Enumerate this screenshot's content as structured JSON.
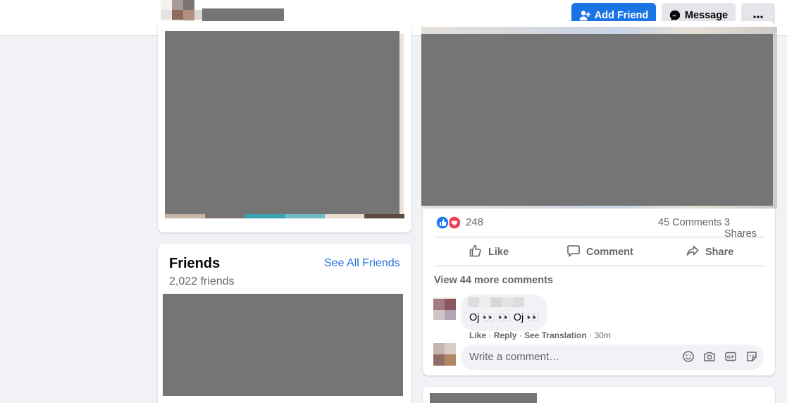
{
  "header": {
    "add_friend_label": "Add Friend",
    "message_label": "Message",
    "more_icon": "more-horizontal-icon",
    "brand_color": "#1b74e4"
  },
  "friends": {
    "title": "Friends",
    "count": "2,022 friends",
    "see_all_label": "See All Friends"
  },
  "post": {
    "reaction_icons": [
      "like-reaction-icon",
      "love-reaction-icon"
    ],
    "reaction_count": "248",
    "comments_count": "45 Comments",
    "shares_count": "3 Shares",
    "actions": {
      "like": "Like",
      "comment": "Comment",
      "share": "Share"
    },
    "view_more_comments": "View 44 more comments",
    "comment": {
      "text": "Oj 👀 👀 Oj 👀",
      "like": "Like",
      "reply": "Reply",
      "see_translation": "See Translation",
      "time": "30m"
    },
    "write_placeholder": "Write a comment…",
    "write_icons": [
      "emoji-icon",
      "camera-icon",
      "gif-icon",
      "sticker-icon"
    ]
  }
}
